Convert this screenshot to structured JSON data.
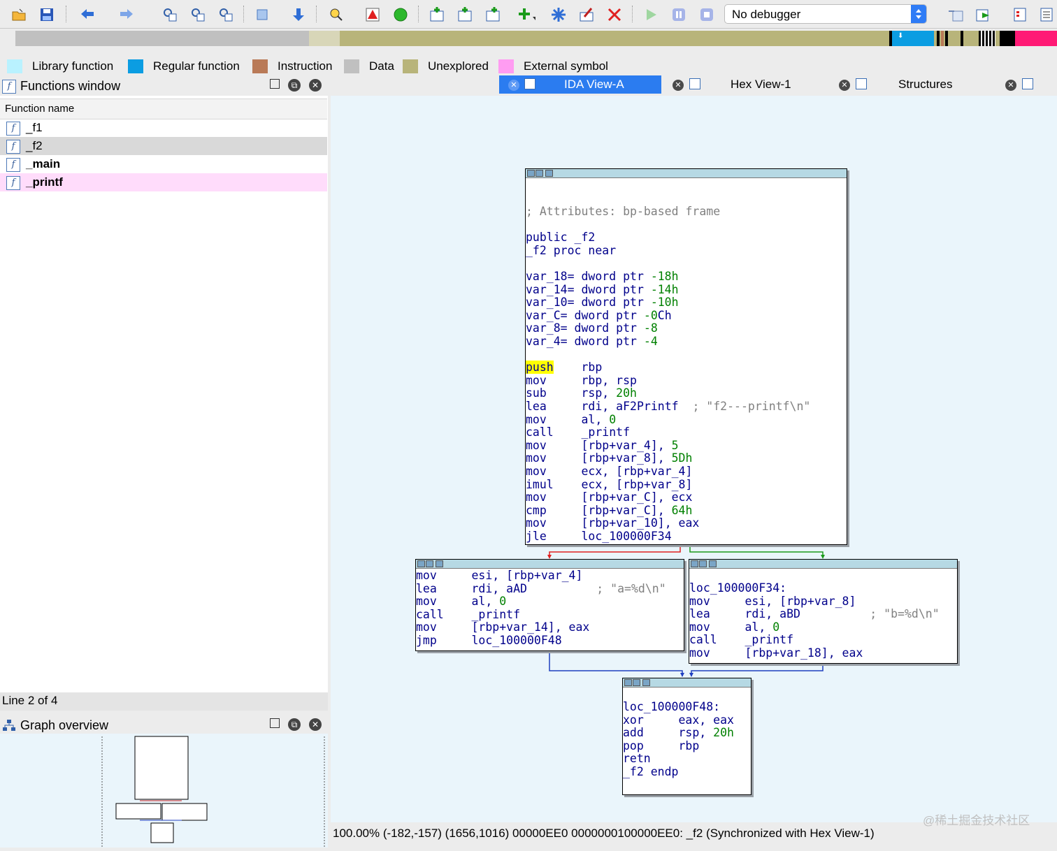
{
  "toolbar": {
    "icons": [
      "open-icon",
      "save-icon",
      "back-icon",
      "forward-icon",
      "search-hex-icon",
      "search-text-icon",
      "search-binary-icon",
      "jump-icon",
      "down-arrow-icon",
      "analyze-icon",
      "warning-icon",
      "green-circle-icon",
      "code-icon",
      "data-icon",
      "ascii-icon",
      "plus-icon",
      "star-icon",
      "edit-icon",
      "delete-icon",
      "play-icon",
      "pause-icon",
      "stop-icon"
    ],
    "debugger_label": "No debugger"
  },
  "legend": [
    {
      "label": "Library function",
      "color": "#b9f2ff"
    },
    {
      "label": "Regular function",
      "color": "#0b9de2"
    },
    {
      "label": "Instruction",
      "color": "#b97a57"
    },
    {
      "label": "Data",
      "color": "#c0c0c0"
    },
    {
      "label": "Unexplored",
      "color": "#b8b47a"
    },
    {
      "label": "External symbol",
      "color": "#ff9cf2"
    }
  ],
  "functions_window": {
    "title": "Functions window",
    "column_header": "Function name",
    "rows": [
      {
        "name": "_f1"
      },
      {
        "name": "_f2"
      },
      {
        "name": "_main"
      },
      {
        "name": "_printf"
      }
    ],
    "status": "Line 2 of 4"
  },
  "graph_overview": {
    "title": "Graph overview"
  },
  "tabs": [
    {
      "label": "IDA View-A",
      "active": true
    },
    {
      "label": "Hex View-1",
      "active": false
    },
    {
      "label": "Structures",
      "active": false
    }
  ],
  "blocks": {
    "top": [
      "; Attributes: bp-based frame",
      "",
      "public _f2",
      "_f2 proc near",
      "",
      "var_18= dword ptr -18h",
      "var_14= dword ptr -14h",
      "var_10= dword ptr -10h",
      "var_C= dword ptr -0Ch",
      "var_8= dword ptr -8",
      "var_4= dword ptr -4",
      "",
      "push    rbp",
      "mov     rbp, rsp",
      "sub     rsp, 20h",
      "lea     rdi, aF2Printf  ; \"f2---printf\\n\"",
      "mov     al, 0",
      "call    _printf",
      "mov     [rbp+var_4], 5",
      "mov     [rbp+var_8], 5Dh",
      "mov     ecx, [rbp+var_4]",
      "imul    ecx, [rbp+var_8]",
      "mov     [rbp+var_C], ecx",
      "cmp     [rbp+var_C], 64h",
      "mov     [rbp+var_10], eax",
      "jle     loc_100000F34"
    ],
    "left": [
      "mov     esi, [rbp+var_4]",
      "lea     rdi, aAD          ; \"a=%d\\n\"",
      "mov     al, 0",
      "call    _printf",
      "mov     [rbp+var_14], eax",
      "jmp     loc_100000F48"
    ],
    "right": [
      "loc_100000F34:",
      "mov     esi, [rbp+var_8]",
      "lea     rdi, aBD          ; \"b=%d\\n\"",
      "mov     al, 0",
      "call    _printf",
      "mov     [rbp+var_18], eax"
    ],
    "bottom": [
      "loc_100000F48:",
      "xor     eax, eax",
      "add     rsp, 20h",
      "pop     rbp",
      "retn",
      "_f2 endp"
    ]
  },
  "statusbar": "100.00% (-182,-157) (1656,1016) 00000EE0 0000000100000EE0: _f2 (Synchronized with Hex View-1)",
  "watermark": "@稀土掘金技术社区"
}
